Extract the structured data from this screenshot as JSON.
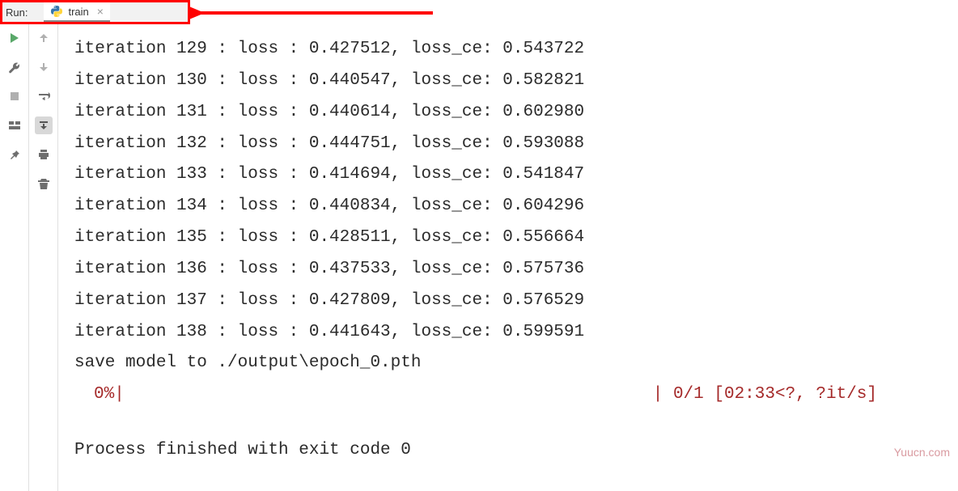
{
  "header": {
    "run_label": "Run:",
    "tab_name": "train"
  },
  "console": {
    "lines": [
      "iteration 129 : loss : 0.427512, loss_ce: 0.543722",
      "iteration 130 : loss : 0.440547, loss_ce: 0.582821",
      "iteration 131 : loss : 0.440614, loss_ce: 0.602980",
      "iteration 132 : loss : 0.444751, loss_ce: 0.593088",
      "iteration 133 : loss : 0.414694, loss_ce: 0.541847",
      "iteration 134 : loss : 0.440834, loss_ce: 0.604296",
      "iteration 135 : loss : 0.428511, loss_ce: 0.556664",
      "iteration 136 : loss : 0.437533, loss_ce: 0.575736",
      "iteration 137 : loss : 0.427809, loss_ce: 0.576529",
      "iteration 138 : loss : 0.441643, loss_ce: 0.599591",
      "save model to ./output\\epoch_0.pth"
    ],
    "progress_pct": "0%|",
    "progress_stats": "| 0/1 [02:33<?, ?it/s]",
    "exit_line": "Process finished with exit code 0"
  },
  "watermark": "Yuucn.com"
}
